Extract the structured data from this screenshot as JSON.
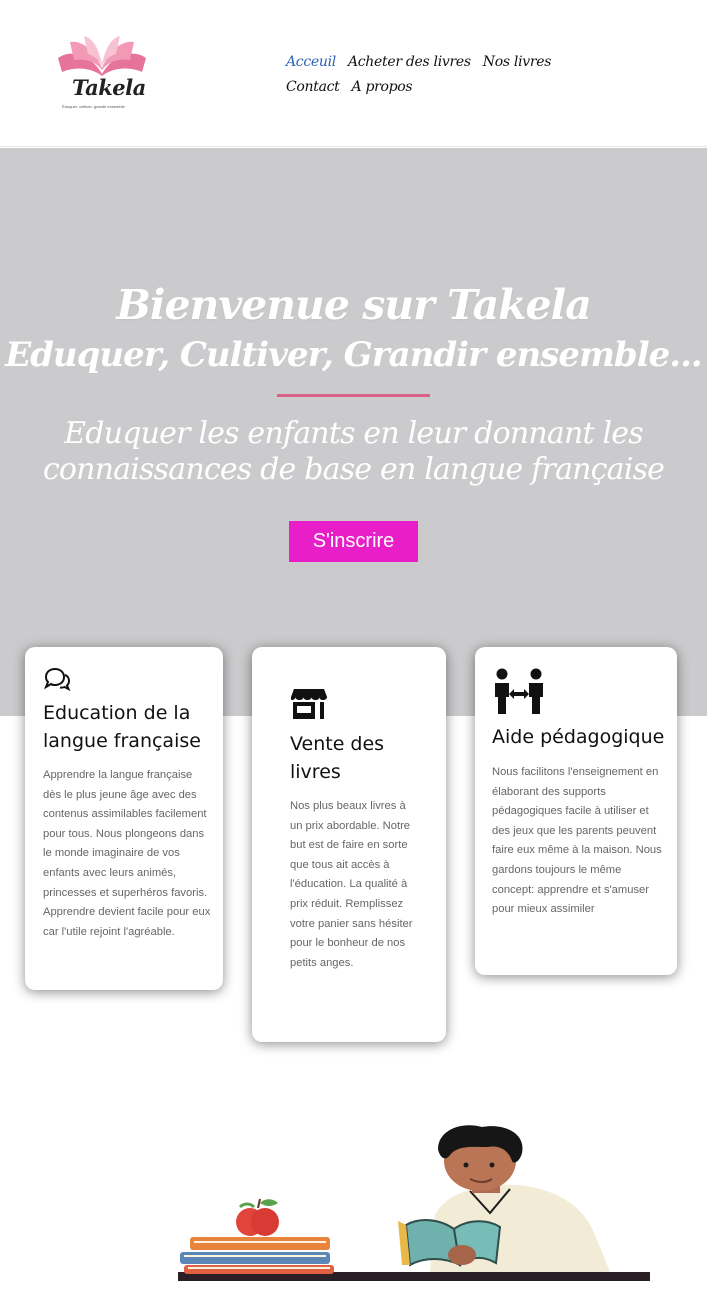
{
  "header": {
    "logo_word": "Takela",
    "logo_tagline": "Éduquer, cultiver, grandir ensemble",
    "nav": [
      {
        "label": "Acceuil",
        "active": true
      },
      {
        "label": "Acheter des livres",
        "active": false
      },
      {
        "label": "Nos livres",
        "active": false
      },
      {
        "label": "Contact",
        "active": false
      },
      {
        "label": "A propos",
        "active": false
      }
    ]
  },
  "hero": {
    "title": "Bienvenue sur Takela",
    "subtitle": "Eduquer, Cultiver, Grandir ensemble...",
    "lead": "Eduquer les enfants en leur donnant les connaissances de base en langue française",
    "cta_label": "S'inscrire"
  },
  "features": [
    {
      "icon": "chat-bubbles-icon",
      "title": "Education de la langue française",
      "text": "Apprendre la langue française dès le plus jeune âge avec des contenus assimilables facilement pour tous. Nous plongeons dans le monde imaginaire de vos enfants avec leurs animés, princesses et superhéros favoris. Apprendre devient facile pour eux car l'utile rejoint l'agréable."
    },
    {
      "icon": "store-icon",
      "title": "Vente des livres",
      "text": "Nos plus beaux livres à un prix abordable. Notre but est de faire en sorte que tous ait accès à l'éducation. La qualité à prix réduit. Remplissez votre panier sans hésiter pour le bonheur de nos petits anges."
    },
    {
      "icon": "people-exchange-icon",
      "title": "Aide pédagogique",
      "text": "Nous facilitons l'enseignement en élaborant des supports pédagogiques facile à utiliser et des jeux que les parents peuvent faire eux même à la maison. Nous gardons toujours le même concept: apprendre et s'amuser pour mieux assimiler"
    }
  ],
  "colors": {
    "accent": "#e81fc8",
    "nav_active": "#2e62b5",
    "divider": "#d8628a",
    "hero_bg": "#cbcbcd"
  }
}
